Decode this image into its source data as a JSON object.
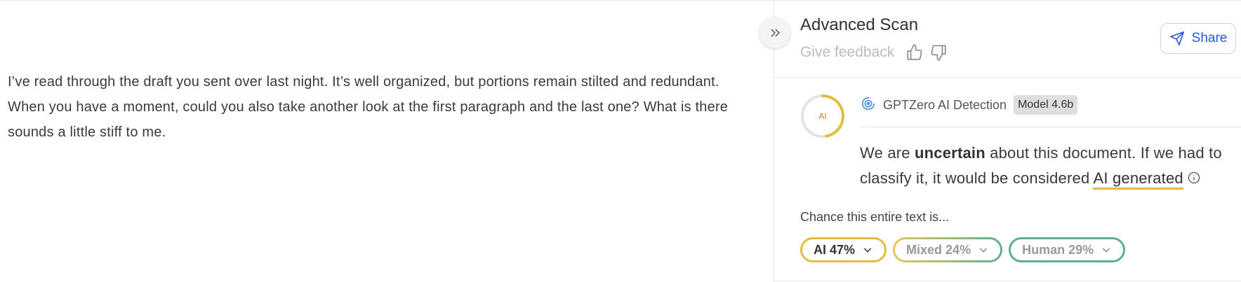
{
  "editor": {
    "text": "I’ve read through the draft you sent over last night. It’s well organized, but portions remain stilted and redundant. When you have a moment, could you also take another look at the first paragraph and the last one? What is there sounds a little stiff to me."
  },
  "panel": {
    "title": "Advanced Scan",
    "feedback_label": "Give feedback",
    "share_label": "Share",
    "ring_label": "AI",
    "detection_label": "GPTZero AI Detection",
    "model_badge": "Model 4.6b",
    "verdict_pre": "We are ",
    "verdict_bold": "uncertain",
    "verdict_mid": " about this document. If we had to classify it, it would be considered ",
    "verdict_link": "AI generated",
    "chance_label": "Chance this entire text is...",
    "pills": {
      "ai": "AI 47%",
      "mixed": "Mixed 24%",
      "human": "Human 29%"
    },
    "ai_probability": 0.47
  },
  "colors": {
    "ai": "#e4bd3e",
    "human": "#5fae94",
    "accent": "#2a5bd7"
  },
  "icons": [
    "chevrons-right-icon",
    "thumbs-up-icon",
    "thumbs-down-icon",
    "send-icon",
    "target-icon",
    "info-icon",
    "chevron-down-icon"
  ]
}
